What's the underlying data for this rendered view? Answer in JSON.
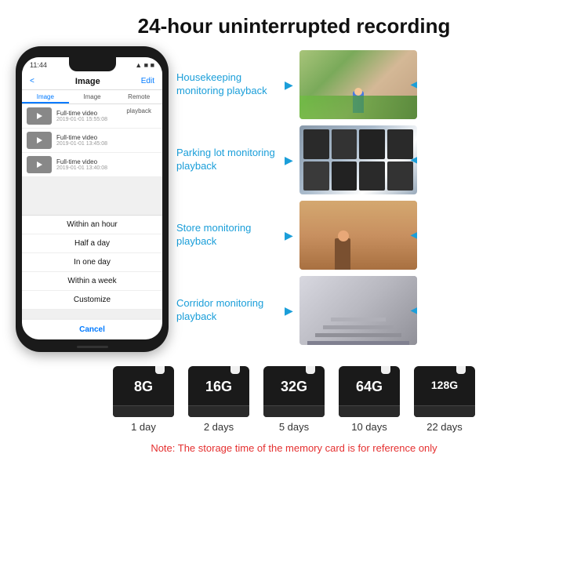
{
  "header": {
    "title": "24-hour uninterrupted recording"
  },
  "phone": {
    "status_time": "11:44",
    "nav_back": "<",
    "nav_title": "Image",
    "nav_edit": "Edit",
    "tabs": [
      "Image",
      "Image",
      "Remote playback"
    ],
    "active_tab": 0,
    "videos": [
      {
        "title": "Full-time video",
        "date": "2019-01-01 15:55:08"
      },
      {
        "title": "Full-time video",
        "date": "2019-01-01 13:45:08"
      },
      {
        "title": "Full-time video",
        "date": "2019-01-01 13:40:08"
      }
    ],
    "dropdown_items": [
      "Within an hour",
      "Half a day",
      "In one day",
      "Within a week",
      "Customize"
    ],
    "cancel_label": "Cancel"
  },
  "monitoring": [
    {
      "label_line1": "Housekeeping",
      "label_line2": "monitoring playback"
    },
    {
      "label_line1": "Parking lot",
      "label_line2": "monitoring playback"
    },
    {
      "label_line1": "Store monitoring",
      "label_line2": "playback"
    },
    {
      "label_line1": "Corridor monitoring",
      "label_line2": "playback"
    }
  ],
  "storage": {
    "cards": [
      {
        "size": "8G",
        "days": "1 day"
      },
      {
        "size": "16G",
        "days": "2 days"
      },
      {
        "size": "32G",
        "days": "5 days"
      },
      {
        "size": "64G",
        "days": "10 days"
      },
      {
        "size": "128G",
        "days": "22 days"
      }
    ],
    "note": "Note: The storage time of the memory card is for reference only"
  }
}
